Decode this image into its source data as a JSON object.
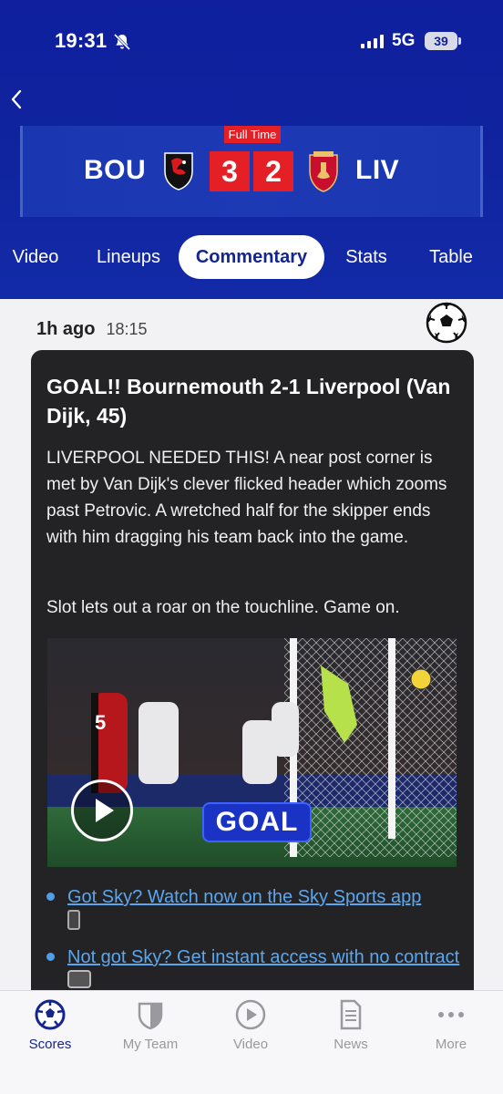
{
  "status_bar": {
    "time": "19:31",
    "network": "5G",
    "battery": "39"
  },
  "match": {
    "status": "Full Time",
    "home_team": "BOU",
    "away_team": "LIV",
    "home_score": "3",
    "away_score": "2"
  },
  "tabs": [
    {
      "label": "Video",
      "active": false
    },
    {
      "label": "Lineups",
      "active": false
    },
    {
      "label": "Commentary",
      "active": true
    },
    {
      "label": "Stats",
      "active": false
    },
    {
      "label": "Table",
      "active": false
    }
  ],
  "post": {
    "time_ago": "1h ago",
    "clock": "18:15",
    "title": "GOAL!! Bournemouth 2-1 Liverpool (Van Dijk, 45)",
    "paragraph1": "LIVERPOOL NEEDED THIS! A near post corner is met by Van Dijk's clever flicked header which zooms past Petrovic. A wretched half for the skipper ends with him dragging his team back into the game.",
    "paragraph2": "Slot lets out a roar on the touchline. Game on.",
    "video_badge": "GOAL",
    "links": [
      "Got Sky? Watch now on the Sky Sports app",
      "Not got Sky? Get instant access with no contract"
    ]
  },
  "bottom_nav": [
    {
      "label": "Scores",
      "active": true
    },
    {
      "label": "My Team",
      "active": false
    },
    {
      "label": "Video",
      "active": false
    },
    {
      "label": "News",
      "active": false
    },
    {
      "label": "More",
      "active": false
    }
  ],
  "colors": {
    "header_blue": "#10249f",
    "score_red": "#e42026",
    "link_blue": "#5aa7f0",
    "card_dark": "#232326"
  }
}
